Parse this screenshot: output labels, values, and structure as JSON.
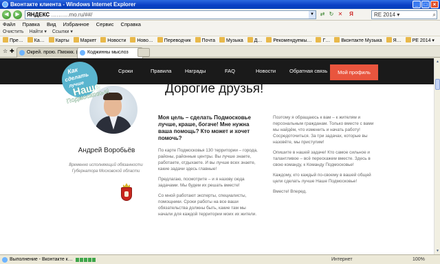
{
  "window": {
    "title": "Вконтакте клиента - Windows Internet Explorer"
  },
  "address": {
    "domain": "ЯНДЕКС",
    "rest": "……….mo.ru/##/",
    "search_value": "RE 2014 ▾"
  },
  "menu": [
    "Файл",
    "Правка",
    "Вид",
    "Избранное",
    "Сервис",
    "Справка"
  ],
  "toolbar": [
    "Очистить",
    "Найти ▾",
    "Ссылки ▾"
  ],
  "favorites": [
    "Пре…",
    "Ка…",
    "Карты",
    "Маркет",
    "Новости",
    "Ново…",
    "Переводчик",
    "Почта",
    "Музыка",
    "Д…",
    "Рекомендуемы…",
    "Г…",
    "Вконтакте Музыка",
    "Я…",
    "РЕ 2014 ▾"
  ],
  "tabs": [
    {
      "label": "Окрей. прою. Пмоккк. (…",
      "active": false
    },
    {
      "label": "Коджинны мыслоз",
      "active": true
    }
  ],
  "site_nav": {
    "links": [
      "Сроки",
      "Правила",
      "Награды",
      "FAQ",
      "Новости",
      "Обратная связь"
    ],
    "profile": "Мой профиль"
  },
  "logo": {
    "line1": "Как",
    "line2": "сделать",
    "line3": "лучше",
    "line4": "Наше",
    "line5": "Подмосковье!"
  },
  "person": {
    "name": "Андрей Воробьёв",
    "role": "Временно исполняющий обязанности Губернатора Московской области"
  },
  "headline": "Дорогие друзья!",
  "col1": {
    "lead": "Моя цель – сделать Подмосковье лучше, краше, богаче! Мне нужна ваша помощь? Кто может и хочет помочь?",
    "paragraphs": [
      "По карте Подмосковья 130 территории – города, районы, районные центры. Вы лучше знаете, работаете, отдыхаете. И вы лучше всех знаете, какие задачи здесь главные!",
      "Предлагаю, посмотрите – и я назову сюда задачами. Мы будем их решать вместе!",
      "Со мной работают эксперты, специалисты, помощники. Сроки работы на все ваши обязательства должны быть, какие там мы начали для каждой территории моих их жители."
    ]
  },
  "col2": {
    "paragraphs": [
      "Поэтому я обращаюсь к вам – к жителям и персональным гражданам. Только вместе с вами мы найдём, что изменить и начать работу! Сосредоточиться. За три задачах, которые вы назовёте, мы приступим!",
      "Опишите в нашей задаче! Кто самое сильное и талантливое – всё перескажем вместе. Здесь в свою команду, к Команду Подмосковье!",
      "Каждому, кто каждый по-своему в вашей общей цели сделать лучше Наше Подмосковье!",
      "Вместе! Вперед."
    ]
  },
  "status": {
    "text": "Выполнение - Вконтакте к…",
    "zone": "Интернет",
    "zoom": "100%"
  }
}
